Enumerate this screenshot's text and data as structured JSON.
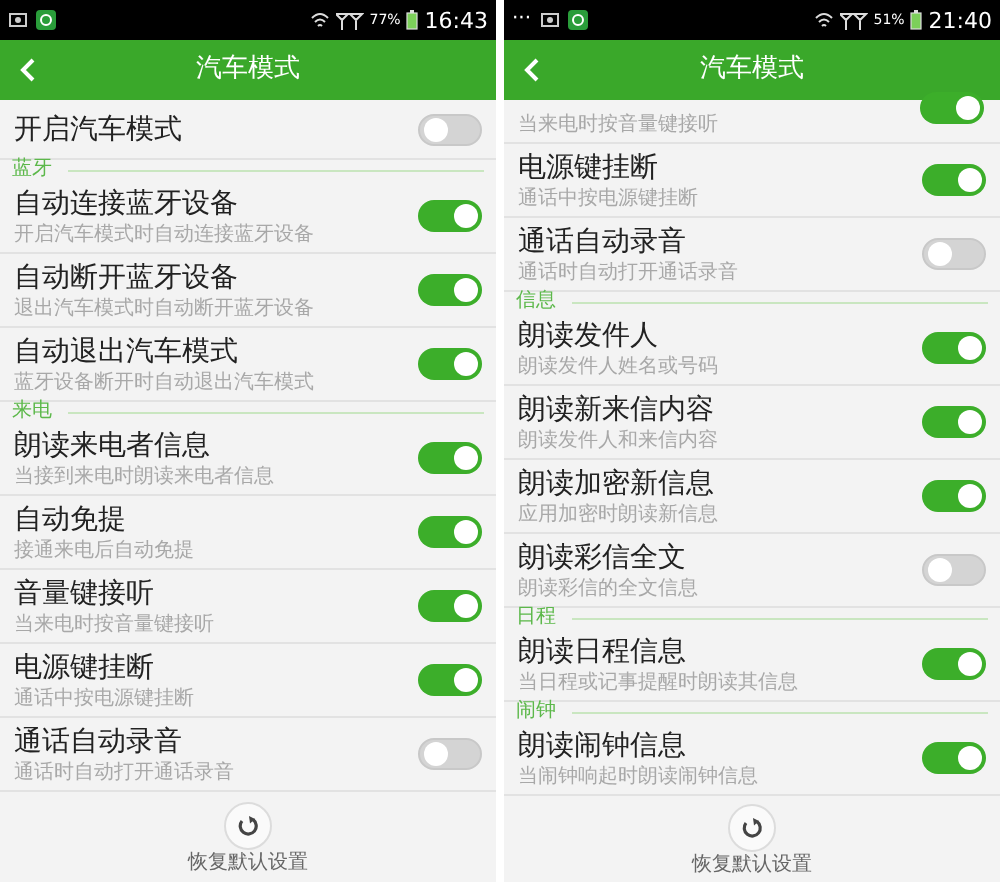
{
  "screens": [
    {
      "status_bar": {
        "battery": "77%",
        "time": "16:43"
      },
      "title": "汽车模式",
      "items": [
        {
          "kind": "toggle",
          "title": "开启汽车模式",
          "on": false
        },
        {
          "kind": "section",
          "label": "蓝牙"
        },
        {
          "kind": "toggle",
          "title": "自动连接蓝牙设备",
          "subtitle": "开启汽车模式时自动连接蓝牙设备",
          "on": true
        },
        {
          "kind": "toggle",
          "title": "自动断开蓝牙设备",
          "subtitle": "退出汽车模式时自动断开蓝牙设备",
          "on": true
        },
        {
          "kind": "toggle",
          "title": "自动退出汽车模式",
          "subtitle": "蓝牙设备断开时自动退出汽车模式",
          "on": true
        },
        {
          "kind": "section",
          "label": "来电"
        },
        {
          "kind": "toggle",
          "title": "朗读来电者信息",
          "subtitle": "当接到来电时朗读来电者信息",
          "on": true
        },
        {
          "kind": "toggle",
          "title": "自动免提",
          "subtitle": "接通来电后自动免提",
          "on": true
        },
        {
          "kind": "toggle",
          "title": "音量键接听",
          "subtitle": "当来电时按音量键接听",
          "on": true
        },
        {
          "kind": "toggle",
          "title": "电源键挂断",
          "subtitle": "通话中按电源键挂断",
          "on": true
        },
        {
          "kind": "toggle",
          "title": "通话自动录音",
          "subtitle": "通话时自动打开通话录音",
          "on": false
        }
      ],
      "footer": {
        "label": "恢复默认设置"
      }
    },
    {
      "status_bar": {
        "overflow": "···",
        "battery": "51%",
        "time": "21:40"
      },
      "title": "汽车模式",
      "items": [
        {
          "kind": "partial",
          "subtitle": "当来电时按音量键接听",
          "on": true
        },
        {
          "kind": "toggle",
          "title": "电源键挂断",
          "subtitle": "通话中按电源键挂断",
          "on": true
        },
        {
          "kind": "toggle",
          "title": "通话自动录音",
          "subtitle": "通话时自动打开通话录音",
          "on": false
        },
        {
          "kind": "section",
          "label": "信息"
        },
        {
          "kind": "toggle",
          "title": "朗读发件人",
          "subtitle": "朗读发件人姓名或号码",
          "on": true
        },
        {
          "kind": "toggle",
          "title": "朗读新来信内容",
          "subtitle": "朗读发件人和来信内容",
          "on": true
        },
        {
          "kind": "toggle",
          "title": "朗读加密新信息",
          "subtitle": "应用加密时朗读新信息",
          "on": true
        },
        {
          "kind": "toggle",
          "title": "朗读彩信全文",
          "subtitle": "朗读彩信的全文信息",
          "on": false
        },
        {
          "kind": "section",
          "label": "日程"
        },
        {
          "kind": "toggle",
          "title": "朗读日程信息",
          "subtitle": "当日程或记事提醒时朗读其信息",
          "on": true
        },
        {
          "kind": "section",
          "label": "闹钟"
        },
        {
          "kind": "toggle",
          "title": "朗读闹钟信息",
          "subtitle": "当闹钟响起时朗读闹钟信息",
          "on": true
        }
      ],
      "footer": {
        "label": "恢复默认设置"
      }
    }
  ]
}
